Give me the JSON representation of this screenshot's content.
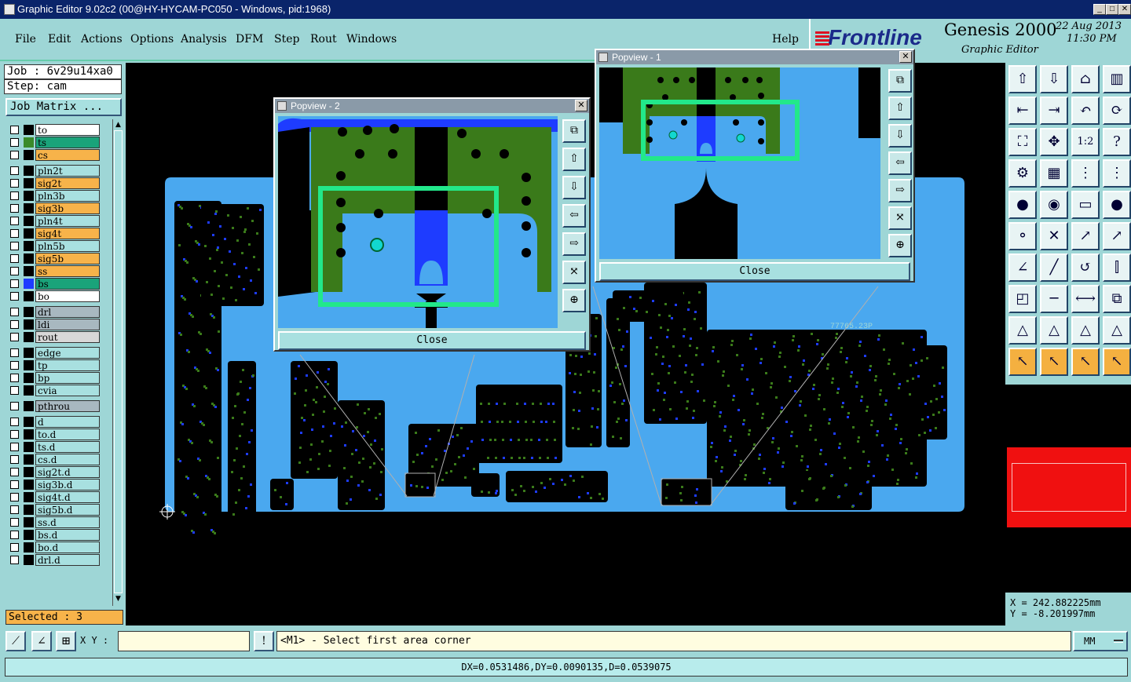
{
  "window": {
    "title": "Graphic Editor 9.02c2 (00@HY-HYCAM-PC050 - Windows, pid:1968)",
    "min_label": "_",
    "max_label": "□",
    "close_label": "✕"
  },
  "menu": [
    "File",
    "Edit",
    "Actions",
    "Options",
    "Analysis",
    "DFM",
    "Step",
    "Rout",
    "Windows"
  ],
  "help_label": "Help",
  "brand": {
    "logo_text": "Frontline",
    "product": "Genesis 2000",
    "subtitle": "Graphic Editor",
    "date": "22 Aug 2013",
    "time": "11:30 PM"
  },
  "job": {
    "job_line": "Job : 6v29u14xa0",
    "step_line": "Step: cam",
    "matrix_button": "Job Matrix ..."
  },
  "layers": [
    {
      "name": "to",
      "bg": "#ffffff",
      "swatch": "#000000"
    },
    {
      "name": "ts",
      "bg": "#1aa37a",
      "swatch": "#3a8a2a"
    },
    {
      "name": "cs",
      "bg": "#f7b34a",
      "swatch": "#000000"
    },
    {
      "name": "pln2t",
      "bg": "#a8e0e0",
      "swatch": "#000000"
    },
    {
      "name": "sig2t",
      "bg": "#f7b34a",
      "swatch": "#000000"
    },
    {
      "name": "pln3b",
      "bg": "#a8e0e0",
      "swatch": "#000000"
    },
    {
      "name": "sig3b",
      "bg": "#f7b34a",
      "swatch": "#000000"
    },
    {
      "name": "pln4t",
      "bg": "#a8e0e0",
      "swatch": "#000000"
    },
    {
      "name": "sig4t",
      "bg": "#f7b34a",
      "swatch": "#000000"
    },
    {
      "name": "pln5b",
      "bg": "#a8e0e0",
      "swatch": "#000000"
    },
    {
      "name": "sig5b",
      "bg": "#f7b34a",
      "swatch": "#000000"
    },
    {
      "name": "ss",
      "bg": "#f7b34a",
      "swatch": "#000000"
    },
    {
      "name": "bs",
      "bg": "#1aa37a",
      "swatch": "#1e3cff"
    },
    {
      "name": "bo",
      "bg": "#ffffff",
      "swatch": "#000000"
    },
    {
      "name": "drl",
      "bg": "#a8b8c0",
      "swatch": "#000000"
    },
    {
      "name": "ldi",
      "bg": "#a8b8c0",
      "swatch": "#000000"
    },
    {
      "name": "rout",
      "bg": "#d8d8d8",
      "swatch": "#000000"
    },
    {
      "name": "edge",
      "bg": "#a8e0e0",
      "swatch": "#000000"
    },
    {
      "name": "tp",
      "bg": "#a8e0e0",
      "swatch": "#000000"
    },
    {
      "name": "bp",
      "bg": "#a8e0e0",
      "swatch": "#000000"
    },
    {
      "name": "cvia",
      "bg": "#a8e0e0",
      "swatch": "#000000"
    },
    {
      "name": "pthrou",
      "bg": "#a8b8c0",
      "swatch": "#000000"
    },
    {
      "name": "d",
      "bg": "#a8e0e0",
      "swatch": "#000000"
    },
    {
      "name": "to.d",
      "bg": "#a8e0e0",
      "swatch": "#000000"
    },
    {
      "name": "ts.d",
      "bg": "#a8e0e0",
      "swatch": "#000000"
    },
    {
      "name": "cs.d",
      "bg": "#a8e0e0",
      "swatch": "#000000"
    },
    {
      "name": "sig2t.d",
      "bg": "#a8e0e0",
      "swatch": "#000000"
    },
    {
      "name": "sig3b.d",
      "bg": "#a8e0e0",
      "swatch": "#000000"
    },
    {
      "name": "sig4t.d",
      "bg": "#a8e0e0",
      "swatch": "#000000"
    },
    {
      "name": "sig5b.d",
      "bg": "#a8e0e0",
      "swatch": "#000000"
    },
    {
      "name": "ss.d",
      "bg": "#a8e0e0",
      "swatch": "#000000"
    },
    {
      "name": "bs.d",
      "bg": "#a8e0e0",
      "swatch": "#000000"
    },
    {
      "name": "bo.d",
      "bg": "#a8e0e0",
      "swatch": "#000000"
    },
    {
      "name": "drl.d",
      "bg": "#a8e0e0",
      "swatch": "#000000"
    }
  ],
  "selected_text": "Selected : 3",
  "popview2": {
    "title": "Popview - 2",
    "close_label": "Close"
  },
  "popview1": {
    "title": "Popview - 1",
    "close_label": "Close"
  },
  "board_label": "77765.23P",
  "coords": {
    "x": "X = 242.882225mm",
    "y": "Y = -8.201997mm"
  },
  "status": {
    "xy_label": "X Y :",
    "xy_value": "",
    "bang": "!",
    "prompt": "<M1> - Select first area corner",
    "units": "MM"
  },
  "measurement": "DX=0.0531486,DY=0.0090135,D=0.0539075",
  "tool_icons": [
    "zoom-home",
    "zoom-up",
    "home",
    "layout",
    "pan-left",
    "pan-right",
    "undo-view",
    "redraw",
    "fit",
    "center",
    "scale-1-2",
    "query",
    "drill",
    "grid",
    "route-a",
    "route-b",
    "pad",
    "flash",
    "ruler",
    "circle",
    "connect",
    "cross",
    "move",
    "move-b",
    "line",
    "line-b",
    "arc",
    "snap",
    "add-pad",
    "cut",
    "dim",
    "copy",
    "triangle",
    "triangle-b",
    "triangle-c",
    "triangle-d",
    "pointer",
    "pointer-b",
    "pointer-c",
    "pointer-d"
  ],
  "colors": {
    "board": "#4aa8ef",
    "copper": "#3a7a1a",
    "highlight": "#22e88a",
    "accent": "#1e3cff"
  }
}
